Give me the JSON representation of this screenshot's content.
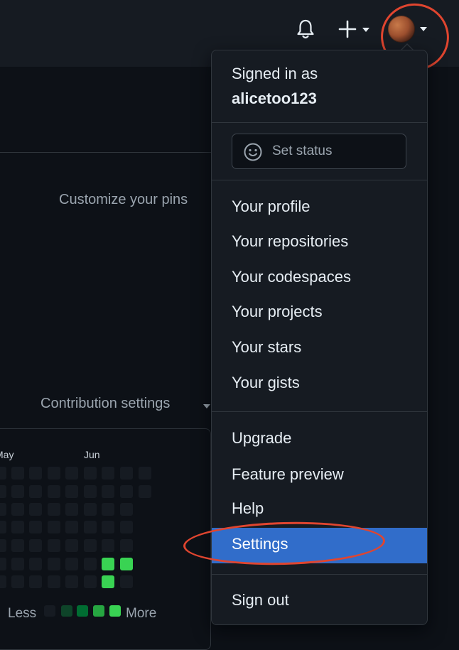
{
  "header": {
    "notifications_icon": "bell-icon",
    "create_icon": "plus-icon",
    "avatar_icon": "user-avatar"
  },
  "profile_page": {
    "pinned_text": "Customize your pins",
    "contribution_settings_label": "Contribution settings",
    "graph": {
      "months": [
        "May",
        "Jun"
      ],
      "legend_less": "Less",
      "legend_more": "More",
      "colors": {
        "empty": "#161b22",
        "level1": "#0e4429",
        "level2": "#006d32",
        "level3": "#26a641",
        "level4": "#39d353"
      }
    }
  },
  "user_menu": {
    "signed_in_label": "Signed in as",
    "username": "alicetoo123",
    "set_status_label": "Set status",
    "set_status_icon": "smiley-icon",
    "group1": [
      "Your profile",
      "Your repositories",
      "Your codespaces",
      "Your projects",
      "Your stars",
      "Your gists"
    ],
    "group2": [
      "Upgrade",
      "Feature preview",
      "Help",
      "Settings"
    ],
    "selected_item": "Settings",
    "sign_out_label": "Sign out"
  },
  "colors": {
    "highlight": "#316dca",
    "annotation": "#e0452f"
  }
}
